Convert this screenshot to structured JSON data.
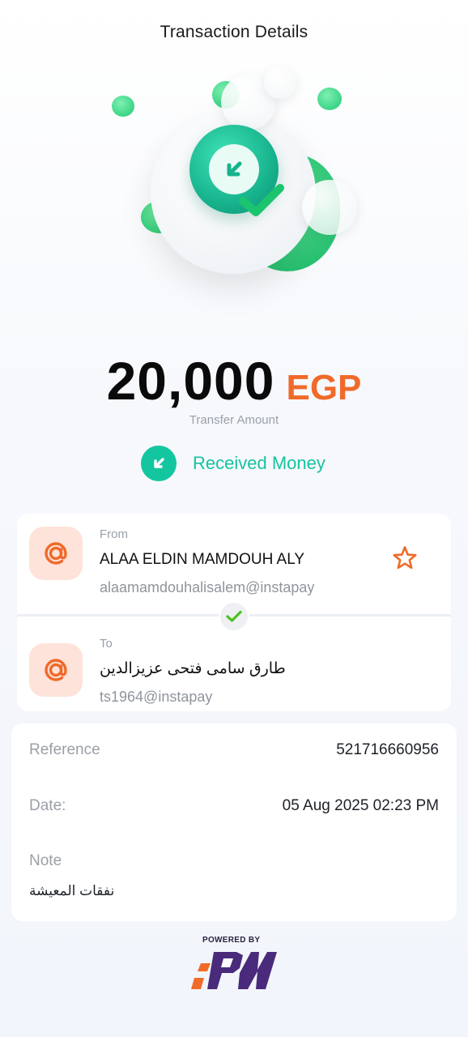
{
  "header": {
    "title": "Transaction Details"
  },
  "amount": {
    "value": "20,000",
    "currency": "EGP",
    "label": "Transfer Amount"
  },
  "status": {
    "text": "Received Money",
    "color": "#17c3a0"
  },
  "from": {
    "caption": "From",
    "name": "ALAA ELDIN MAMDOUH ALY",
    "handle": "alaamamdouhalisalem@instapay"
  },
  "to": {
    "caption": "To",
    "name": "طارق سامى فتحى عزيزالدين",
    "handle": "ts1964@instapay"
  },
  "details": {
    "reference_label": "Reference",
    "reference_value": "521716660956",
    "date_label": "Date:",
    "date_value": "05 Aug 2025 02:23 PM",
    "note_label": "Note",
    "note_value": "نفقات المعيشة"
  },
  "footer": {
    "powered_by": "POWERED BY",
    "logo_text": "IPN"
  },
  "colors": {
    "accent_orange": "#f06a2a",
    "accent_teal": "#13c6a0",
    "success_green": "#22c55e"
  }
}
